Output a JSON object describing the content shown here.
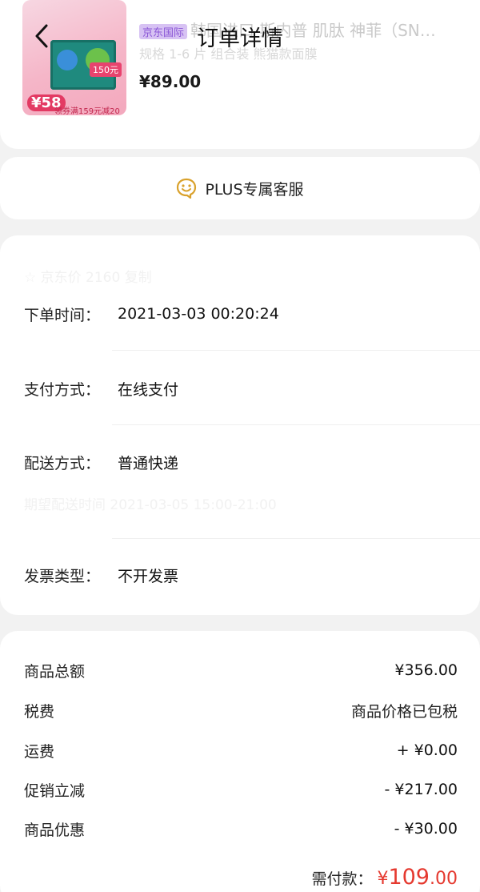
{
  "header": {
    "title": "订单详情"
  },
  "product": {
    "badge": "京东国际",
    "title": "韩国进口 斯内普 肌肽 神菲（SNP）面膜…",
    "spec": "规格 1-6 片 组合装 熊猫款面膜",
    "price": "¥89.00",
    "thumb_tag": "150元",
    "thumb_price": "¥58",
    "thumb_coupon": "领券满159元减20元"
  },
  "service": {
    "label": "PLUS专属客服"
  },
  "order_info": {
    "ghost_row_1": "☆ 京东价        2160    复制",
    "ghost_row_2": "期望配送时间       2021-03-05 15:00-21:00",
    "rows": [
      {
        "label": "下单时间：",
        "value": "2021-03-03 00:20:24"
      },
      {
        "label": "支付方式：",
        "value": "在线支付"
      },
      {
        "label": "配送方式：",
        "value": "普通快递"
      },
      {
        "label": "发票类型：",
        "value": "不开发票"
      }
    ]
  },
  "price_summary": {
    "rows": [
      {
        "label": "商品总额",
        "value": "¥356.00"
      },
      {
        "label": "税费",
        "value": "商品价格已包税"
      },
      {
        "label": "运费",
        "value": "+ ¥0.00"
      },
      {
        "label": "促销立减",
        "value": "- ¥217.00"
      },
      {
        "label": "商品优惠",
        "value": "- ¥30.00"
      }
    ],
    "total_label": "需付款：",
    "total_currency": "¥",
    "total_int": "109",
    "total_dec": ".00"
  },
  "colors": {
    "accent_red": "#e5392f",
    "service_icon": "#d9a12b",
    "page_bg": "#f2f2f2"
  },
  "icons": {
    "back": "chevron-left-icon",
    "service": "smile-chat-icon"
  }
}
